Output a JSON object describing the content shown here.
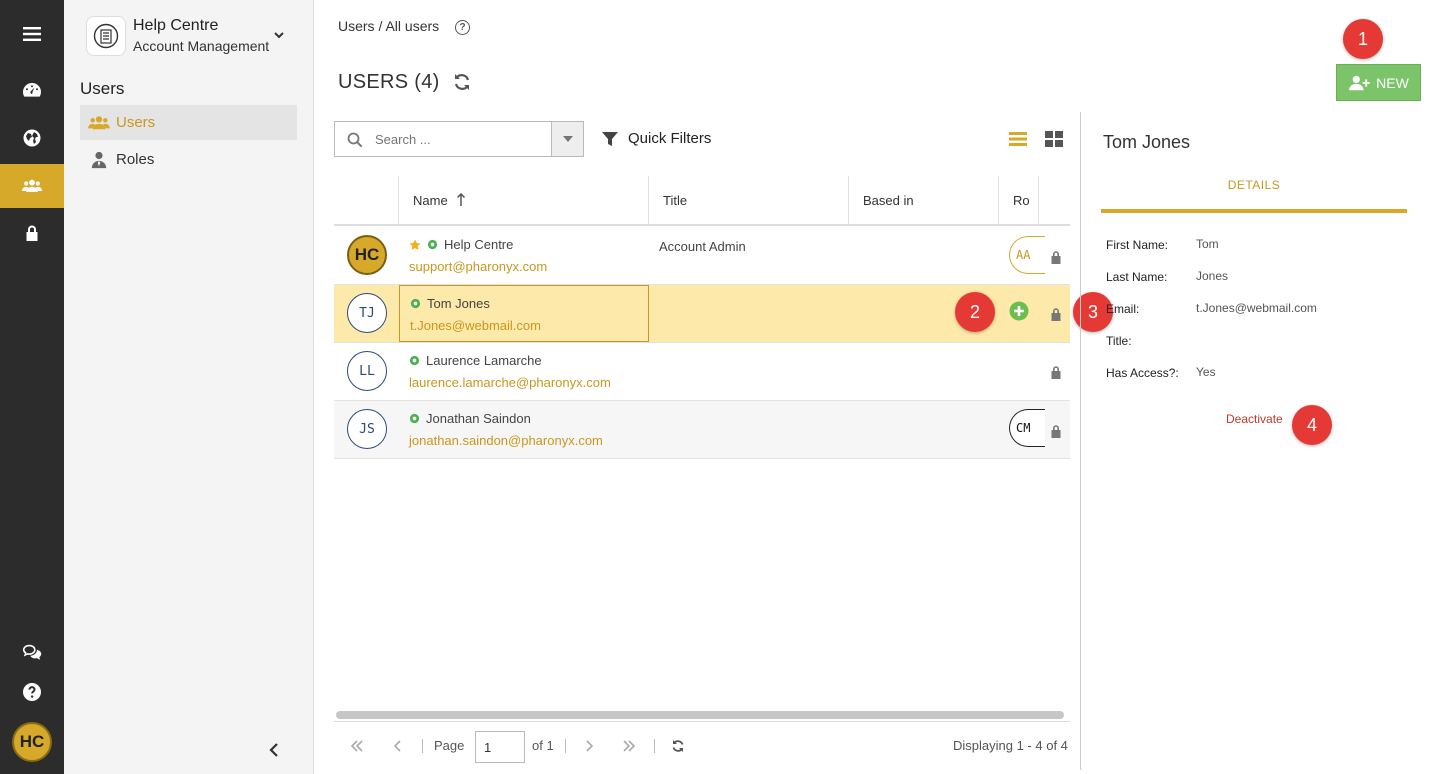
{
  "rail": {
    "avatar_initials": "HC",
    "items": [
      "menu-icon",
      "dashboard-icon",
      "globe-icon",
      "users-icon",
      "lock-icon",
      "chat-icon",
      "help-icon"
    ],
    "active": "users-icon",
    "accent": "#d6a92b"
  },
  "sidebar": {
    "org_name": "Help Centre",
    "org_subtitle": "Account Management",
    "section_title": "Users",
    "items": [
      {
        "label": "Users",
        "icon": "users-icon",
        "active": true
      },
      {
        "label": "Roles",
        "icon": "user-tie-icon",
        "active": false
      }
    ]
  },
  "header": {
    "breadcrumb": "Users / All users",
    "help": "?",
    "title": "USERS (4)",
    "new_label": "NEW"
  },
  "toolbar": {
    "search_placeholder": "Search ...",
    "quick_filters_label": "Quick Filters"
  },
  "table": {
    "columns": [
      "Name",
      "Title",
      "Based in",
      "Ro"
    ],
    "rows": [
      {
        "initials": "HC",
        "name": "Help Centre",
        "email": "support@pharonyx.com",
        "title": "Account Admin",
        "role": "AA",
        "starred": true,
        "selected": false
      },
      {
        "initials": "TJ",
        "name": "Tom Jones",
        "email": "t.Jones@webmail.com",
        "title": "",
        "role": "",
        "starred": false,
        "selected": true
      },
      {
        "initials": "LL",
        "name": "Laurence Lamarche",
        "email": "laurence.lamarche@pharonyx.com",
        "title": "",
        "role": "",
        "starred": false,
        "selected": false
      },
      {
        "initials": "JS",
        "name": "Jonathan Saindon",
        "email": "jonathan.saindon@pharonyx.com",
        "title": "",
        "role": "CM",
        "starred": false,
        "selected": false
      }
    ]
  },
  "pager": {
    "page_label": "Page",
    "page_value": "1",
    "of_label": "of 1",
    "displaying": "Displaying 1 - 4 of 4"
  },
  "detail": {
    "name": "Tom Jones",
    "tab": "DETAILS",
    "fields": [
      {
        "label": "First Name:",
        "value": "Tom"
      },
      {
        "label": "Last Name:",
        "value": "Jones"
      },
      {
        "label": "Email:",
        "value": "t.Jones@webmail.com"
      },
      {
        "label": "Title:",
        "value": ""
      },
      {
        "label": "Has Access?:",
        "value": "Yes"
      }
    ],
    "deactivate_label": "Deactivate"
  },
  "badges": [
    "1",
    "2",
    "3",
    "4"
  ],
  "colors": {
    "accent": "#d6a92b",
    "new_button": "#7cc46a",
    "badge": "#e53935",
    "selected_row": "#fde9a9",
    "deactivate": "#c0392b"
  }
}
